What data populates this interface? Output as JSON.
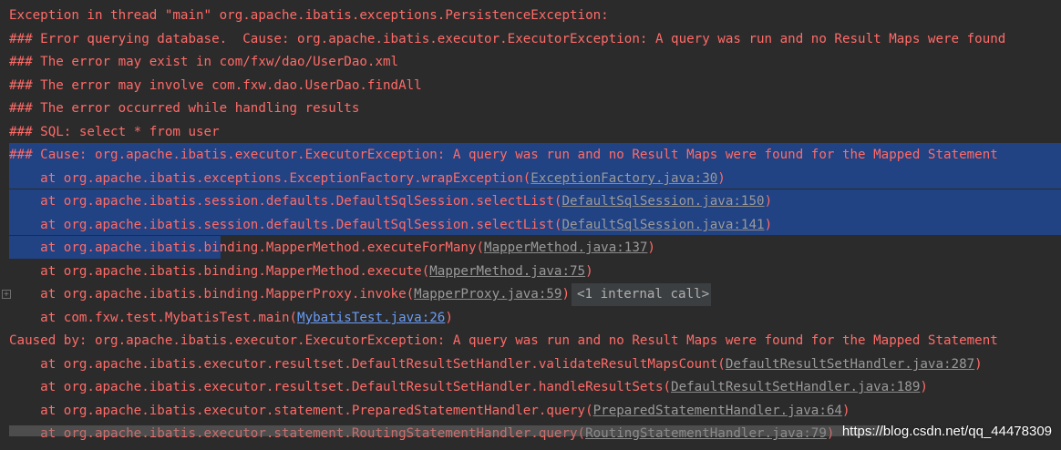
{
  "console": {
    "lines": [
      {
        "text": "Exception in thread \"main\" org.apache.ibatis.exceptions.PersistenceException: "
      },
      {
        "text": "### Error querying database.  Cause: org.apache.ibatis.executor.ExecutorException: A query was run and no Result Maps were found"
      },
      {
        "text": "### The error may exist in com/fxw/dao/UserDao.xml"
      },
      {
        "text": "### The error may involve com.fxw.dao.UserDao.findAll"
      },
      {
        "text": "### The error occurred while handling results"
      },
      {
        "text": "### SQL: select * from user"
      },
      {
        "text": "### Cause: org.apache.ibatis.executor.ExecutorException: A query was run and no Result Maps were found for the Mapped Statement"
      },
      {
        "prefix": "    at org.apache.ibatis.exceptions.ExceptionFactory.wrapException(",
        "link": "ExceptionFactory.java:30",
        "suffix": ")"
      },
      {
        "prefix": "    at org.apache.ibatis.session.defaults.DefaultSqlSession.selectList(",
        "link": "DefaultSqlSession.java:150",
        "suffix": ")"
      },
      {
        "prefix": "    at org.apache.ibatis.session.defaults.DefaultSqlSession.selectList(",
        "link": "DefaultSqlSession.java:141",
        "suffix": ")"
      },
      {
        "prefix": "    at org.apache.ibatis.binding.MapperMethod.executeForMany(",
        "link": "MapperMethod.java:137",
        "suffix": ")"
      },
      {
        "prefix": "    at org.apache.ibatis.binding.MapperMethod.execute(",
        "link": "MapperMethod.java:75",
        "suffix": ")"
      },
      {
        "prefix": "    at org.apache.ibatis.binding.MapperProxy.invoke(",
        "link": "MapperProxy.java:59",
        "suffix": ")",
        "internal": "<1 internal call>"
      },
      {
        "prefix": "    at com.fxw.test.MybatisTest.main(",
        "link": "MybatisTest.java:26",
        "suffix": ")"
      },
      {
        "text": "Caused by: org.apache.ibatis.executor.ExecutorException: A query was run and no Result Maps were found for the Mapped Statement"
      },
      {
        "prefix": "    at org.apache.ibatis.executor.resultset.DefaultResultSetHandler.validateResultMapsCount(",
        "link": "DefaultResultSetHandler.java:287",
        "suffix": ")"
      },
      {
        "prefix": "    at org.apache.ibatis.executor.resultset.DefaultResultSetHandler.handleResultSets(",
        "link": "DefaultResultSetHandler.java:189",
        "suffix": ")"
      },
      {
        "prefix": "    at org.apache.ibatis.executor.statement.PreparedStatementHandler.query(",
        "link": "PreparedStatementHandler.java:64",
        "suffix": ")"
      },
      {
        "prefix": "    at org.apache.ibatis.executor.statement.RoutingStatementHandler.query(",
        "link": "RoutingStatementHandler.java:79",
        "suffix": ")"
      }
    ]
  },
  "watermark": "https://blog.csdn.net/qq_44478309",
  "colors": {
    "background": "#2b2b2b",
    "error_text": "#ff6b68",
    "selection": "#214283",
    "link": "#9a9a9a",
    "visited_link": "#6a9cf5"
  }
}
